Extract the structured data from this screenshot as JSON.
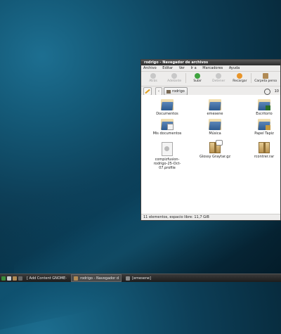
{
  "window": {
    "title": "rodrigo - Navegador de archivos",
    "menu": [
      "Archivo",
      "Editar",
      "Ver",
      "Ir a",
      "Marcadores",
      "Ayuda"
    ],
    "toolbar": [
      {
        "label": "Atrás",
        "icon": "back-arrow-icon",
        "enabled": false
      },
      {
        "label": "Adelante",
        "icon": "forward-arrow-icon",
        "enabled": false
      },
      {
        "label": "Subir",
        "icon": "up-arrow-icon",
        "enabled": true,
        "color": "#3fa33f"
      },
      {
        "label": "Detener",
        "icon": "stop-icon",
        "enabled": false
      },
      {
        "label": "Recargar",
        "icon": "reload-icon",
        "enabled": true,
        "color": "#e8952a"
      },
      {
        "label": "Carpeta perso",
        "icon": "home-folder-icon",
        "enabled": true
      }
    ],
    "location": {
      "crumb": "rodrigo",
      "zoom": "10"
    },
    "files": [
      {
        "name": "Documentos",
        "type": "folder"
      },
      {
        "name": "emesene",
        "type": "folder"
      },
      {
        "name": "Escritorio",
        "type": "folder-desktop"
      },
      {
        "name": "Mis documentos",
        "type": "folder-docs"
      },
      {
        "name": "Música",
        "type": "folder-music"
      },
      {
        "name": "Papel Tapiz",
        "type": "folder-image"
      },
      {
        "name": "compizfusion-rodrigo-25-Oct-07.profile",
        "type": "document"
      },
      {
        "name": "Glossy Graytar.gz",
        "type": "package"
      },
      {
        "name": "rcontrer.rar",
        "type": "package"
      }
    ],
    "status": "11 elementos, espacio libre: 11,7 GiB"
  },
  "taskbar": {
    "tasks": [
      {
        "label": "[ Add Content GNOME-",
        "active": false
      },
      {
        "label": "rodrigo - Navegador d",
        "active": true
      },
      {
        "label": "[emesene]",
        "active": false
      }
    ]
  },
  "colors": {
    "folder_blue": "#2d5a8f",
    "up_green": "#3fa33f",
    "reload_orange": "#e8952a"
  }
}
